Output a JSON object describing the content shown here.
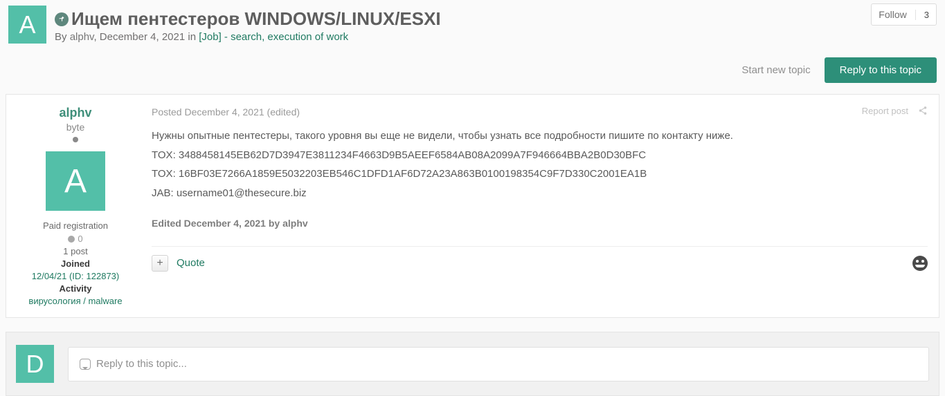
{
  "header": {
    "avatar_letter": "A",
    "title": "Ищем пентестеров WINDOWS/LINUX/ESXI",
    "byline_prefix": "By",
    "byline_author": "alphv",
    "byline_sep": ",",
    "byline_date": "December 4, 2021",
    "byline_in": "in",
    "byline_forum": "[Job] - search, execution of work",
    "follow_label": "Follow",
    "follow_count": "3"
  },
  "actions": {
    "start_new_topic": "Start new topic",
    "reply_to_topic": "Reply to this topic"
  },
  "post": {
    "author": "alphv",
    "rank": "byte",
    "avatar_letter": "A",
    "paid_reg": "Paid registration",
    "reputation": "0",
    "post_count": "1 post",
    "joined_label": "Joined",
    "joined_value": "12/04/21 (ID: 122873)",
    "activity_label": "Activity",
    "activity_value": "вирусология / malware",
    "posted_prefix": "Posted ",
    "posted_date": "December 4, 2021",
    "posted_suffix": " (edited)",
    "report_label": "Report post",
    "body_lines": [
      "Нужны опытные пентестеры, такого уровня вы еще не видели, чтобы узнать все подробности пишите по контакту ниже.",
      "TOX: 3488458145EB62D7D3947E3811234F4663D9B5AEEF6584AB08A2099A7F946664BBA2B0D30BFC",
      "TOX: 16BF03E7266A1859E5032203EB546C1DFD1AF6D72A23A863B0100198354C9F7D330C2001EA1B",
      "JAB: username01@thesecure.biz"
    ],
    "edited_note": "Edited December 4, 2021 by alphv",
    "quote_label": "Quote"
  },
  "reply": {
    "avatar_letter": "D",
    "placeholder": "Reply to this topic..."
  }
}
